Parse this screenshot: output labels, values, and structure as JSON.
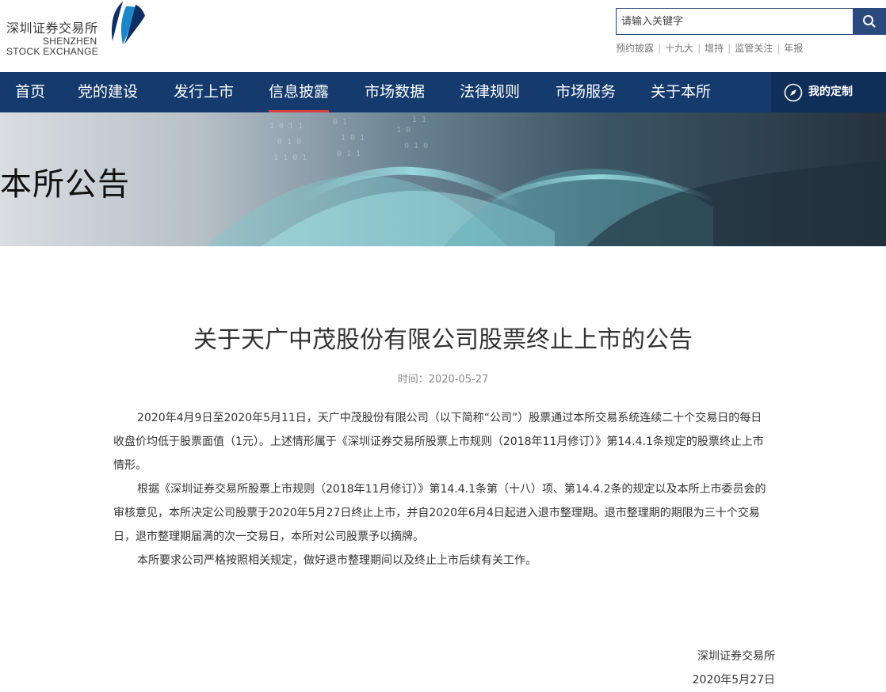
{
  "header": {
    "logo_cn": "深圳证券交易所",
    "logo_en_line1": "SHENZHEN",
    "logo_en_line2": "STOCK EXCHANGE",
    "search_placeholder": "请输入关键字",
    "search_icon": "search-icon",
    "quick_links": [
      "预约披露",
      "十九大",
      "增持",
      "监管关注",
      "年报"
    ]
  },
  "nav": {
    "items": [
      "首页",
      "党的建设",
      "发行上市",
      "信息披露",
      "市场数据",
      "法律规则",
      "市场服务",
      "关于本所"
    ],
    "active": "信息披露",
    "custom_label": "我的定制",
    "custom_icon": "compass-icon"
  },
  "banner": {
    "title": "本所公告"
  },
  "article": {
    "title": "关于天广中茂股份有限公司股票终止上市的公告",
    "date": "时间：2020-05-27",
    "paragraphs": [
      "2020年4月9日至2020年5月11日，天广中茂股份有限公司（以下简称“公司”）股票通过本所交易系统连续二十个交易日的每日收盘价均低于股票面值（1元）。上述情形属于《深圳证券交易所股票上市规则（2018年11月修订）》第14.4.1条规定的股票终止上市情形。",
      "根据《深圳证券交易所股票上市规则（2018年11月修订）》第14.4.1条第（十八）项、第14.4.2条的规定以及本所上市委员会的审核意见，本所决定公司股票于2020年5月27日终止上市，并自2020年6月4日起进入退市整理期。退市整理期的期限为三十个交易日，退市整理期届满的次一交易日，本所对公司股票予以摘牌。",
      "本所要求公司严格按照相关规定，做好退市整理期间以及终止上市后续有关工作。"
    ],
    "signer": "深圳证券交易所",
    "sign_date": "2020年5月27日"
  },
  "colors": {
    "nav_bg": "#143a6e",
    "custom_bg": "#0f2e58",
    "active_underline": "#d64040",
    "search_button": "#2a4a7d"
  }
}
